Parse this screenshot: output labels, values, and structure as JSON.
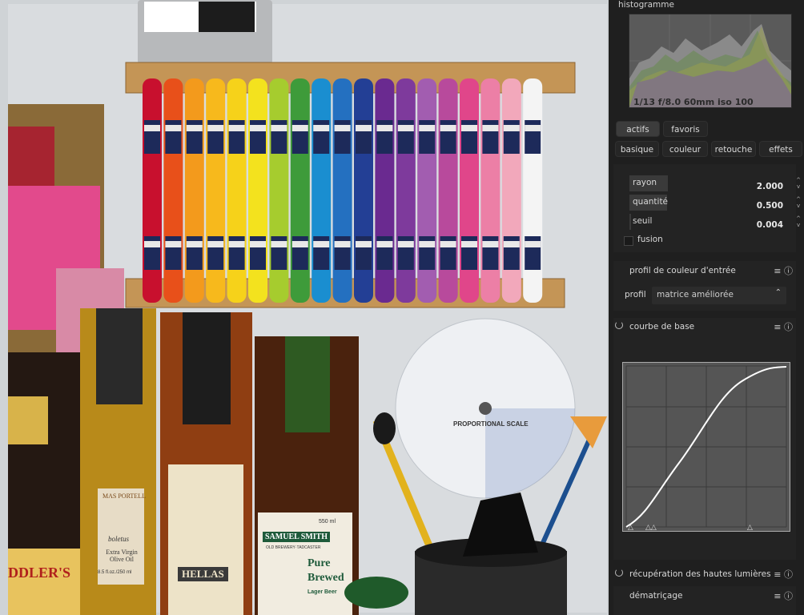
{
  "histogram": {
    "title": "histogramme",
    "info": "1/13 f/8.0 60mm iso 100"
  },
  "tabs_row1": [
    {
      "label": "actifs",
      "active": true
    },
    {
      "label": "favoris",
      "active": false
    }
  ],
  "tabs_row2": [
    {
      "label": "basique"
    },
    {
      "label": "couleur"
    },
    {
      "label": "retouche"
    },
    {
      "label": "effets"
    }
  ],
  "sharpen": {
    "sliders": [
      {
        "label": "rayon",
        "value": "2.000",
        "fill": 0.25
      },
      {
        "label": "quantité",
        "value": "0.500",
        "fill": 0.24
      },
      {
        "label": "seuil",
        "value": "0.004",
        "fill": 0.01
      }
    ],
    "fusion_label": "fusion"
  },
  "input_profile": {
    "title": "profil de couleur d'entrée",
    "profile_label": "profil",
    "profile_value": "matrice améliorée"
  },
  "base_curve": {
    "title": "courbe de base"
  },
  "highlights": {
    "title": "récupération des hautes lumières"
  },
  "demosaic": {
    "title": "dématriçage"
  },
  "photo_text": {
    "scale_title": "PROPORTIONAL SCALE",
    "oil_brand": "MAS PORTELL",
    "oil_sub": "boletus",
    "oil_name": "Extra Virgin Olive Oil",
    "oil_volume": "8.5 fl.oz./250 ml",
    "hellas": "HELLAS",
    "beer_brand": "SAMUEL SMITH",
    "beer_sub": "OLD BREWERY·TADCASTER",
    "beer_name1": "Pure",
    "beer_name2": "Brewed",
    "beer_name3": "Lager Beer",
    "beer_volume": "550 ml",
    "left_label": "DDLER'S"
  },
  "colors": {
    "panel_bg": "#1f1f1f",
    "accent_text": "#d8d8d8"
  }
}
